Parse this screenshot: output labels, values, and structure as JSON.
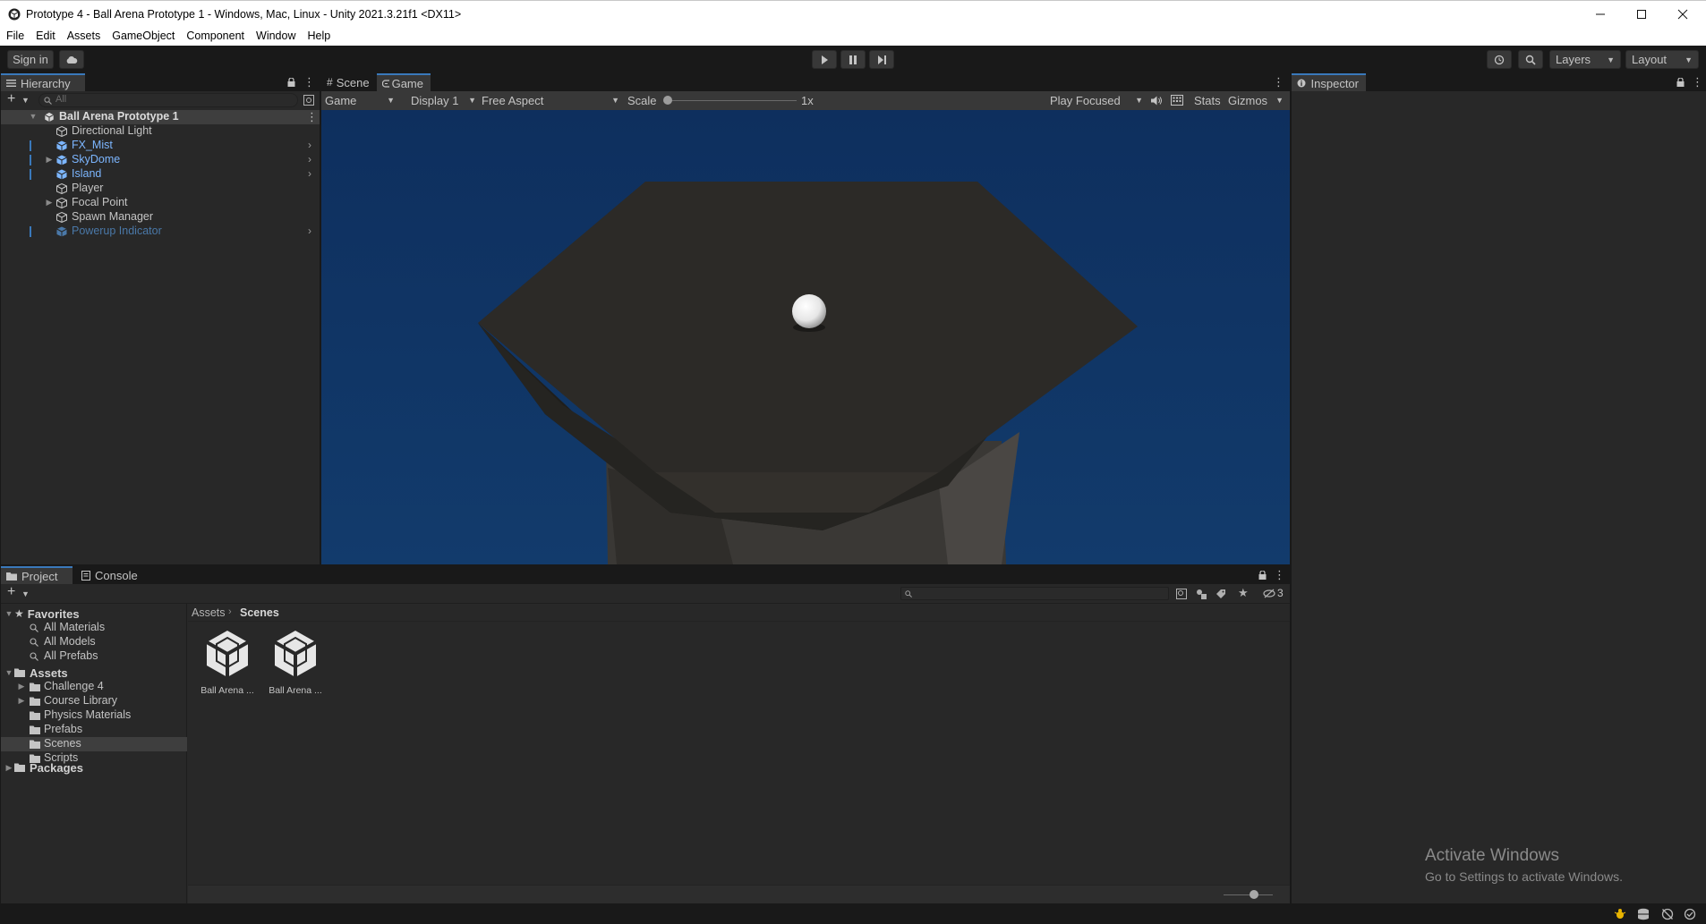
{
  "window": {
    "title": "Prototype 4 - Ball Arena Prototype 1 - Windows, Mac, Linux - Unity 2021.3.21f1 <DX11>",
    "controls": [
      "minimize-icon",
      "maximize-icon",
      "close-icon"
    ]
  },
  "menu": [
    "File",
    "Edit",
    "Assets",
    "GameObject",
    "Component",
    "Window",
    "Help"
  ],
  "toolbar": {
    "sign_in": "Sign in",
    "layers": "Layers",
    "layout": "Layout"
  },
  "hierarchy": {
    "tab": "Hierarchy",
    "search_placeholder": "All",
    "scene": "Ball Arena Prototype 1",
    "items": [
      {
        "label": "Directional Light",
        "prefab": false,
        "expandable": false
      },
      {
        "label": "FX_Mist",
        "prefab": true,
        "expandable": false
      },
      {
        "label": "SkyDome",
        "prefab": true,
        "expandable": true
      },
      {
        "label": "Island",
        "prefab": true,
        "expandable": false
      },
      {
        "label": "Player",
        "prefab": false,
        "expandable": false
      },
      {
        "label": "Focal Point",
        "prefab": false,
        "expandable": true
      },
      {
        "label": "Spawn Manager",
        "prefab": false,
        "expandable": false
      },
      {
        "label": "Powerup Indicator",
        "prefab": true,
        "expandable": false,
        "inactive": true
      }
    ]
  },
  "game_view": {
    "tabs": [
      "Scene",
      "Game"
    ],
    "active_tab": "Game",
    "mode": "Game",
    "display": "Display 1",
    "aspect": "Free Aspect",
    "scale_label": "Scale",
    "scale_value": "1x",
    "play_mode": "Play Focused",
    "stats": "Stats",
    "gizmos": "Gizmos",
    "sky_color": "#0f3566",
    "platform_color": "#2c2a27"
  },
  "inspector": {
    "tab": "Inspector"
  },
  "project": {
    "tabs": [
      "Project",
      "Console"
    ],
    "favorites_label": "Favorites",
    "favorites": [
      "All Materials",
      "All Models",
      "All Prefabs"
    ],
    "assets_label": "Assets",
    "folders": [
      {
        "label": "Challenge 4",
        "expandable": true
      },
      {
        "label": "Course Library",
        "expandable": true
      },
      {
        "label": "Physics Materials",
        "expandable": false
      },
      {
        "label": "Prefabs",
        "expandable": false
      },
      {
        "label": "Scenes",
        "expandable": false,
        "selected": true
      },
      {
        "label": "Scripts",
        "expandable": false
      }
    ],
    "packages_label": "Packages",
    "breadcrumb": [
      "Assets",
      "Scenes"
    ],
    "files": [
      "Ball Arena ...",
      "Ball Arena ..."
    ],
    "hidden_count": "3"
  },
  "watermark": {
    "line1": "Activate Windows",
    "line2": "Go to Settings to activate Windows."
  },
  "colors": {
    "accent": "#3a79bb",
    "prefab_blue": "#7cb6ff",
    "panel": "#282828"
  }
}
